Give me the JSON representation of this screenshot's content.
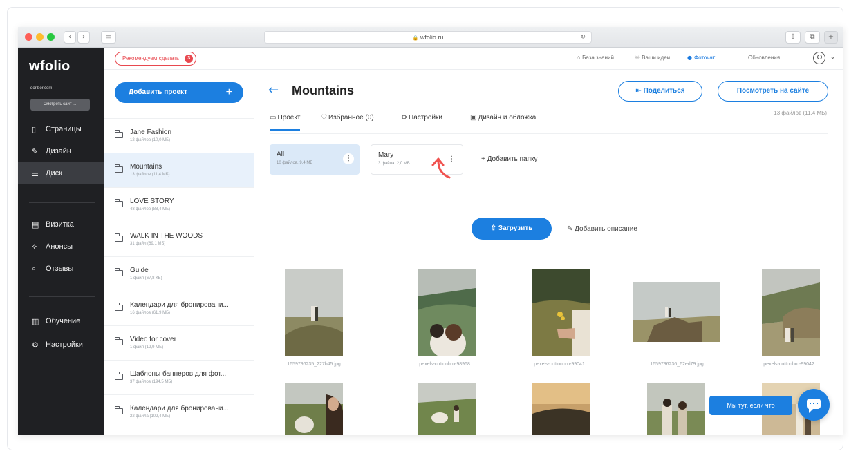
{
  "browser": {
    "url": "wfolio.ru",
    "lock": "🔒",
    "reload": "↻",
    "back": "‹",
    "forward": "›"
  },
  "sidebar": {
    "logo": "wfolio",
    "domain": "doribor.com",
    "see_site": "Смотреть сайт →",
    "items": [
      {
        "label": "Страницы",
        "icon": "file-icon",
        "glyph": "▯"
      },
      {
        "label": "Дизайн",
        "icon": "brush-icon",
        "glyph": "✎"
      },
      {
        "label": "Диск",
        "icon": "database-icon",
        "glyph": "☰"
      },
      {
        "label": "Визитка",
        "icon": "card-icon",
        "glyph": "▤"
      },
      {
        "label": "Анонсы",
        "icon": "megaphone-icon",
        "glyph": "⟡"
      },
      {
        "label": "Отзывы",
        "icon": "chat-icon",
        "glyph": "⌕"
      },
      {
        "label": "Обучение",
        "icon": "book-icon",
        "glyph": "▥"
      },
      {
        "label": "Настройки",
        "icon": "gear-icon",
        "glyph": "⚙"
      }
    ]
  },
  "topbar": {
    "recommend": "Рекомендуем сделать",
    "recommend_count": "3",
    "links": [
      {
        "label": "База знаний",
        "icon": "graduation-icon",
        "glyph": "⌂"
      },
      {
        "label": "Ваши идеи",
        "icon": "bulb-icon",
        "glyph": "☼"
      },
      {
        "label": "Фоточат",
        "icon": "photochat-icon",
        "glyph": "●"
      },
      {
        "label": "Обновления",
        "icon": "",
        "glyph": ""
      }
    ],
    "avatar_chevron": "⌄"
  },
  "projects": {
    "add_label": "Добавить проект",
    "add_plus": "+",
    "items": [
      {
        "name": "Jane Fashion",
        "meta": "12 файлов (10,0 МБ)"
      },
      {
        "name": "Mountains",
        "meta": "13 файлов (11,4 МБ)"
      },
      {
        "name": "LOVE STORY",
        "meta": "48 файлов (88,4 МБ)"
      },
      {
        "name": "WALK IN THE WOODS",
        "meta": "31 файл (69,1 МБ)"
      },
      {
        "name": "Guide",
        "meta": "1 файл (67,8 КБ)"
      },
      {
        "name": "Календари для бронировани...",
        "meta": "16 файлов (61,9 МБ)"
      },
      {
        "name": "Video for cover",
        "meta": "1 файл (12,9 МБ)"
      },
      {
        "name": "Шаблоны баннеров для фот...",
        "meta": "37 файлов (194,5 МБ)"
      },
      {
        "name": "Календари для бронировани...",
        "meta": "22 файла (102,4 МБ)"
      }
    ]
  },
  "main": {
    "back": "←",
    "title": "Mountains",
    "share": "Поделиться",
    "share_icon": "⇤",
    "view_site": "Посмотреть на сайте",
    "files_count": "13 файлов (11,4 МБ)",
    "tabs": [
      {
        "label": "Проект",
        "glyph": "▭"
      },
      {
        "label": "Избранное (0)",
        "glyph": "♡"
      },
      {
        "label": "Настройки",
        "glyph": "⚙"
      },
      {
        "label": "Дизайн и обложка",
        "glyph": "▣"
      }
    ],
    "folders": [
      {
        "name": "All",
        "meta": "10 файлов, 9,4 МБ",
        "menu": "⋮"
      },
      {
        "name": "Mary",
        "meta": "3 файла, 2,0 МБ",
        "menu": "⋮"
      }
    ],
    "add_folder": "+ Добавить папку",
    "upload": "⇧ Загрузить",
    "add_desc": "✎ Добавить описание",
    "files": [
      "1659796235_227b45.jpg",
      "pexels-cottonbro-98968...",
      "pexels-cottonbro-99041...",
      "1659796236_62ed79.jpg",
      "pexels-cottonbro-99042..."
    ]
  },
  "help": {
    "label": "Мы тут, если что"
  },
  "colors": {
    "accent": "#1c7fe0",
    "sidebar_bg": "#1f2023",
    "red": "#e8484f"
  }
}
